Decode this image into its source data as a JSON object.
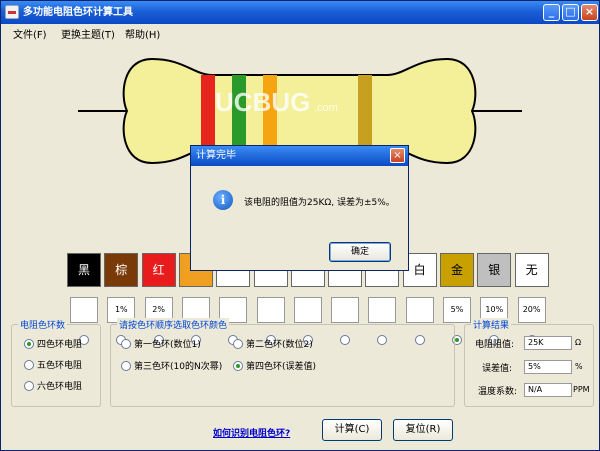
{
  "window": {
    "title": "多功能电阻色环计算工具",
    "minimize": "_",
    "maximize": "□",
    "close": "×"
  },
  "menu": [
    "文件(F)",
    "更换主题(T)",
    "帮助(H)"
  ],
  "watermark": {
    "brand": "UCBUG",
    "suffix": ".com"
  },
  "resistor": {
    "body_color": "#f4ef99",
    "bands": [
      "#e8251c",
      "#2a9a2a",
      "#f6a410",
      "#c8a020"
    ]
  },
  "colors": [
    {
      "label": "黑",
      "bg": "#000000",
      "fg": "#ffffff",
      "pct": ""
    },
    {
      "label": "棕",
      "bg": "#7a3a08",
      "fg": "#ffffff",
      "pct": "1%"
    },
    {
      "label": "红",
      "bg": "#e81c1c",
      "fg": "#ffffff",
      "pct": "2%"
    },
    {
      "label": "",
      "bg": "#f0a020",
      "fg": "#ffffff",
      "pct": ""
    },
    {
      "label": "",
      "bg": "#ffffff",
      "fg": "#000000",
      "pct": ""
    },
    {
      "label": "",
      "bg": "#ffffff",
      "fg": "#000000",
      "pct": ""
    },
    {
      "label": "",
      "bg": "#ffffff",
      "fg": "#000000",
      "pct": ""
    },
    {
      "label": "",
      "bg": "#ffffff",
      "fg": "#000000",
      "pct": ""
    },
    {
      "label": "",
      "bg": "#ffffff",
      "fg": "#000000",
      "pct": ""
    },
    {
      "label": "白",
      "bg": "#ffffff",
      "fg": "#000000",
      "pct": ""
    },
    {
      "label": "金",
      "bg": "#c8a000",
      "fg": "#000000",
      "pct": "5%"
    },
    {
      "label": "银",
      "bg": "#bfbfbf",
      "fg": "#000000",
      "pct": "10%"
    },
    {
      "label": "无",
      "bg": "#ffffff",
      "fg": "#000000",
      "pct": "20%"
    }
  ],
  "selected_tolerance_index": 10,
  "band_count_group": {
    "title": "电阻色环数",
    "options": [
      "四色环电阻",
      "五色环电阻",
      "六色环电阻"
    ],
    "selected": 0
  },
  "band_select_group": {
    "title": "请按色环顺序选取色环颜色",
    "options": [
      "第一色环(数位1)",
      "第二色环(数位2)",
      "第三色环(10的N次幂)",
      "第四色环(误差值)"
    ],
    "selected": 3
  },
  "result_group": {
    "title": "计算结果",
    "resistance_label": "电阻阻值:",
    "resistance_value": "25K",
    "resistance_unit": "Ω",
    "tolerance_label": "误差值:",
    "tolerance_value": "5%",
    "tolerance_unit": "%",
    "tempco_label": "温度系数:",
    "tempco_value": "N/A",
    "tempco_unit": "PPM"
  },
  "help_link": "如何识别电阻色环?",
  "buttons": {
    "calculate": "计算(C)",
    "reset": "复位(R)"
  },
  "dialog": {
    "title": "计算完毕",
    "icon": "i",
    "message": "该电阻的阻值为25KΩ, 误差为±5%。",
    "ok": "确定",
    "close": "×"
  }
}
